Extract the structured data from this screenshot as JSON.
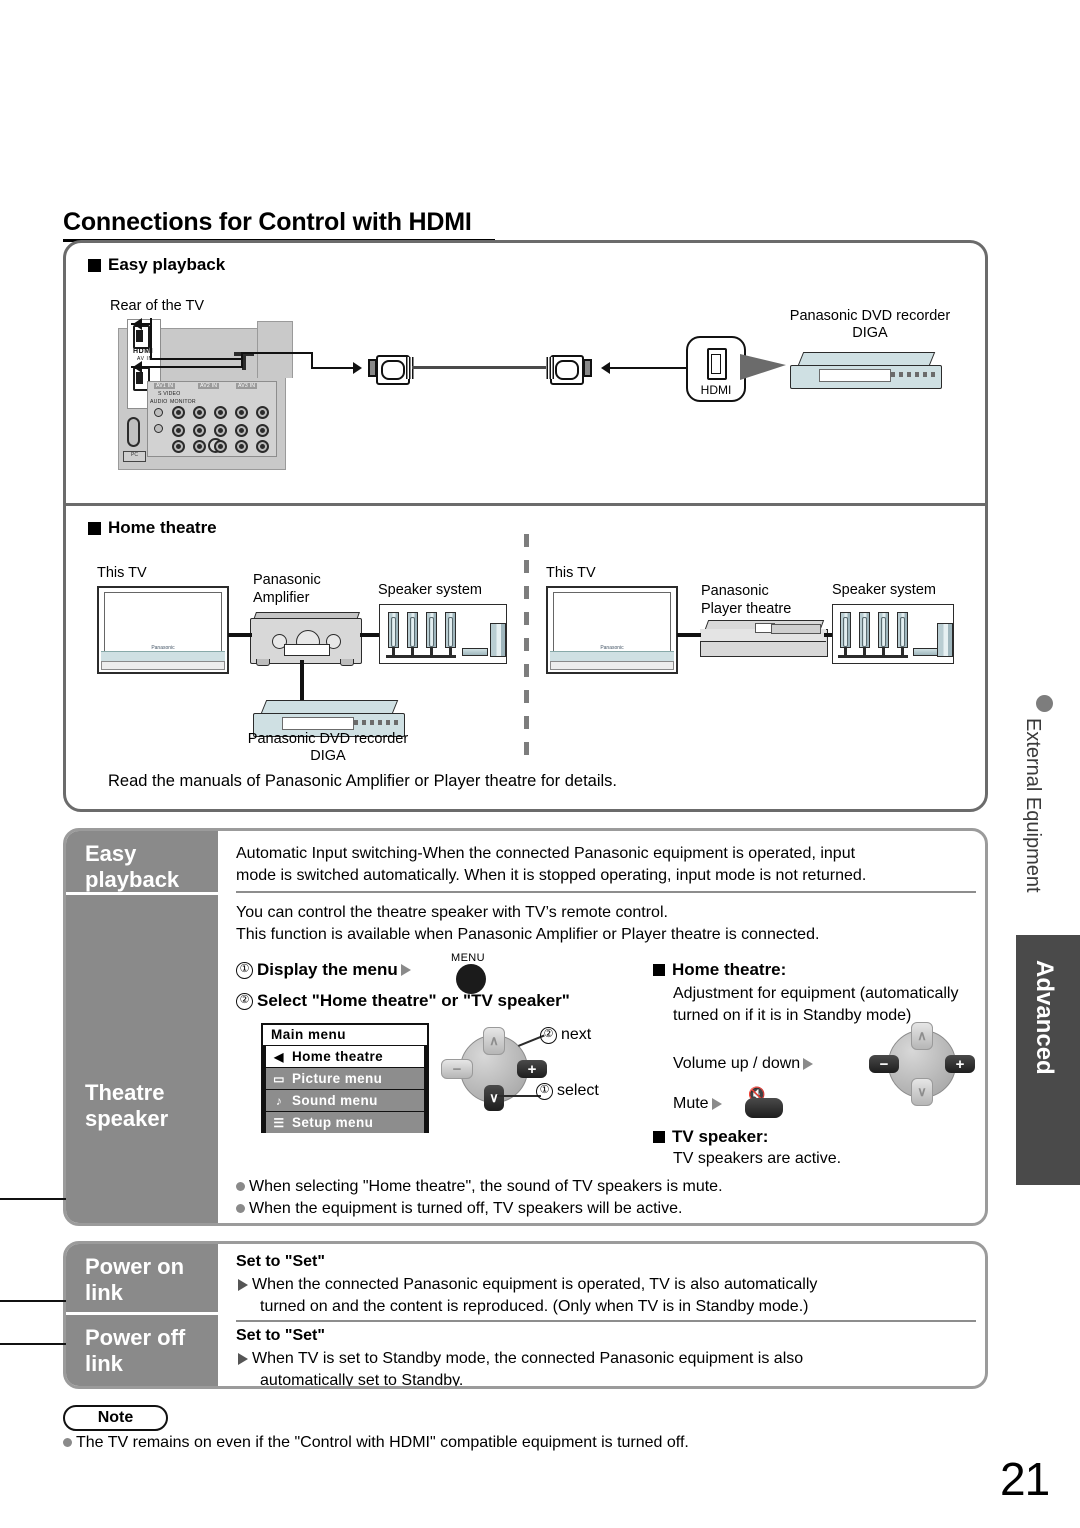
{
  "page": {
    "title": "Connections for Control with HDMI",
    "number": "21"
  },
  "sidebar": {
    "section": "External Equipment",
    "tab": "Advanced"
  },
  "diagram": {
    "easy_playback_heading": "Easy playback",
    "home_theatre_heading": "Home theatre",
    "rear_of_tv": "Rear of the TV",
    "hdmi_label": "HDMI",
    "hdmi_logo": "HDMI",
    "av_in": "AV IN",
    "pc_label": "PC",
    "dvd_recorder": "Panasonic DVD recorder",
    "diga": "DIGA",
    "this_tv": "This TV",
    "amplifier_line1": "Panasonic",
    "amplifier_line2": "Amplifier",
    "player_line1": "Panasonic",
    "player_line2": "Player theatre",
    "speaker_system": "Speaker system",
    "read_manuals": "Read the manuals of Panasonic Amplifier or Player theatre for details."
  },
  "features": {
    "easy_playback_label": "Easy\nplayback",
    "theatre_speaker_label": "Theatre\nspeaker",
    "easy_playback_text_l1": "Automatic Input switching-When the connected Panasonic equipment is operated, input",
    "easy_playback_text_l2": "mode is switched automatically. When it is stopped operating, input mode is not returned.",
    "theatre_text_l1": "You can control the theatre speaker with TV’s remote control.",
    "theatre_text_l2": "This function is available when Panasonic Amplifier or Player theatre is connected.",
    "step1_num": "①",
    "step1": "Display the menu",
    "step2_num": "②",
    "step2": "Select \"Home theatre\" or \"TV speaker\"",
    "menu_button_caption": "MENU",
    "osd": {
      "title": "Main menu",
      "items": [
        {
          "icon": "speaker-icon",
          "glyph": "◀",
          "label": "Home theatre",
          "selected": true
        },
        {
          "icon": "picture-icon",
          "glyph": "▭",
          "label": "Picture menu",
          "selected": false
        },
        {
          "icon": "sound-icon",
          "glyph": "♪",
          "label": "Sound menu",
          "selected": false
        },
        {
          "icon": "setup-icon",
          "glyph": "☰",
          "label": "Setup menu",
          "selected": false
        }
      ]
    },
    "dpad_next_num": "②",
    "dpad_next": "next",
    "dpad_select_num": "①",
    "dpad_select": "select",
    "dpad_up": "∧",
    "dpad_down": "∨",
    "dpad_minus": "−",
    "dpad_plus": "+",
    "home_theatre_title": "Home theatre:",
    "home_theatre_desc_l1": "Adjustment for equipment (automatically",
    "home_theatre_desc_l2": "turned on if it is in Standby mode)",
    "volume_label": "Volume up / down",
    "mute_label": "Mute",
    "tv_speaker_title": "TV speaker:",
    "tv_speaker_desc": "TV speakers are active.",
    "bullet1": "When selecting \"Home theatre\", the sound of TV speakers is mute.",
    "bullet2": "When the equipment is turned off, TV speakers will be active.",
    "power_on_label": "Power on\nlink",
    "power_off_label": "Power off\nlink",
    "set_to_set": "Set to \"Set\"",
    "power_on_l1": "When the connected Panasonic equipment is operated, TV is also automatically",
    "power_on_l2": "turned on and the content is reproduced. (Only when TV is in Standby mode.)",
    "power_off_l1": "When TV is set to Standby mode, the connected Panasonic equipment is also",
    "power_off_l2": "automatically set to Standby."
  },
  "note": {
    "label": "Note",
    "text": "The TV remains on even if the \"Control with HDMI\" compatible equipment is turned off."
  }
}
